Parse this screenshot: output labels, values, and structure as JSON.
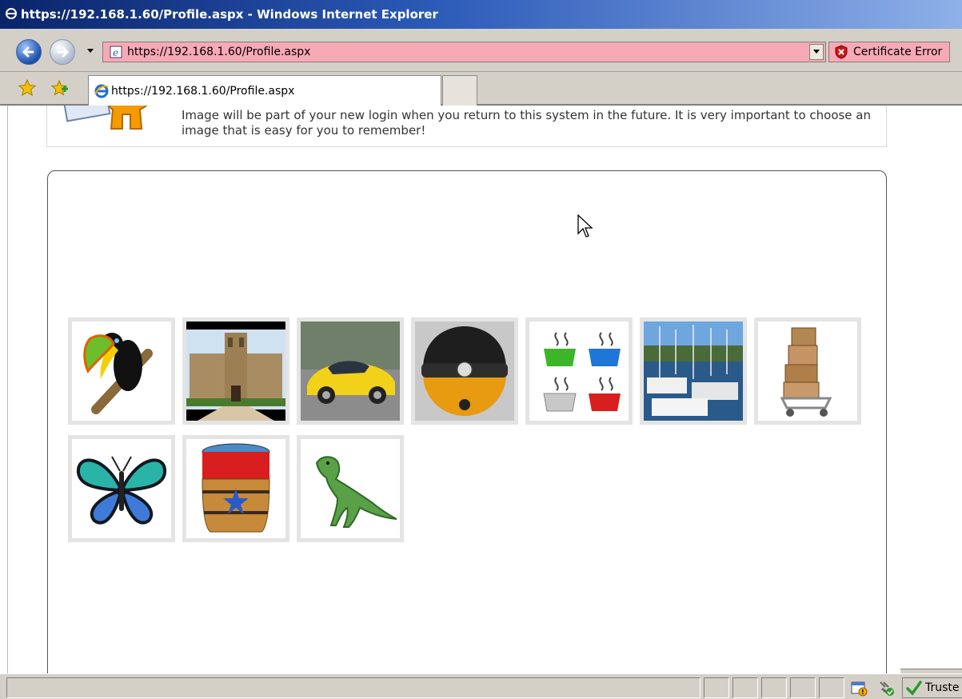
{
  "window": {
    "title": "https://192.168.1.60/Profile.aspx - Windows Internet Explorer"
  },
  "address_bar": {
    "url": "https://192.168.1.60/Profile.aspx",
    "certificate_error_label": "Certificate Error"
  },
  "tab": {
    "label": "https://192.168.1.60/Profile.aspx"
  },
  "info": {
    "text": "Image will be part of your new login when you return to this system in the future. It is very important to choose an image that is easy for you to remember!"
  },
  "images": [
    {
      "name": "toucan"
    },
    {
      "name": "university-building"
    },
    {
      "name": "yellow-sports-car"
    },
    {
      "name": "beanie-emoticon"
    },
    {
      "name": "coffee-cups"
    },
    {
      "name": "marina-boats"
    },
    {
      "name": "boxes-on-cart"
    },
    {
      "name": "butterfly"
    },
    {
      "name": "barrel"
    },
    {
      "name": "dinosaur"
    }
  ],
  "status_bar": {
    "zone_label": "Truste"
  }
}
